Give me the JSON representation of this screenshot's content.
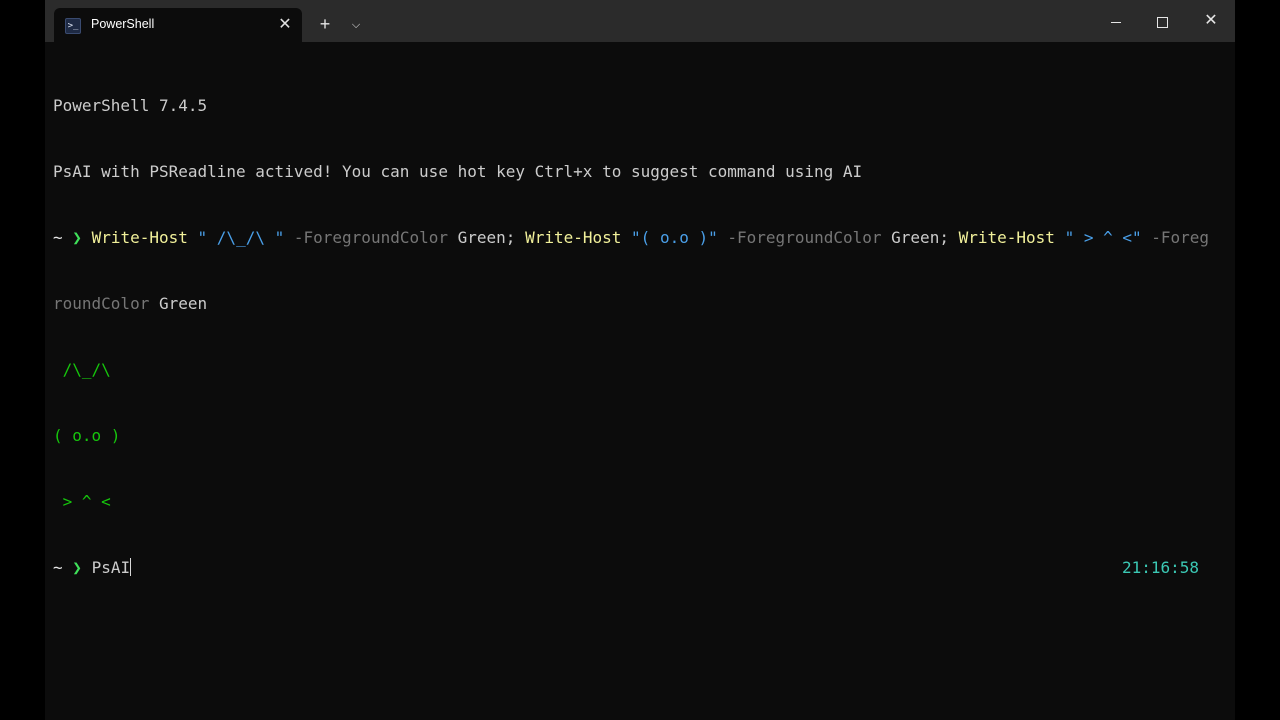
{
  "tab": {
    "icon": "powershell-icon",
    "title": "PowerShell",
    "close": "✕"
  },
  "titlebar": {
    "new_tab": "+",
    "dropdown": "⌵",
    "close": "✕"
  },
  "terminal": {
    "banner_version": "PowerShell 7.4.5",
    "banner_message": "PsAI with PSReadline actived! You can use hot key Ctrl+x to suggest command using AI",
    "prompt_tilde": "~",
    "prompt_chevron": "❯",
    "command1": {
      "c1": "Write-Host",
      "s1": "\" /\\_/\\ \"",
      "p1": "-ForegroundColor",
      "v1": "Green;",
      "c2": "Write-Host",
      "s2": "\"( o.o )\"",
      "p2": "-ForegroundColor",
      "v2": "Green;",
      "c3": "Write-Host",
      "s3": "\" > ^ <\"",
      "p3a": "-Foreg",
      "p3b": "roundColor",
      "v3": "Green"
    },
    "output": [
      " /\\_/\\",
      "( o.o )",
      " > ^ <"
    ],
    "current_input": "PsAI",
    "clock": "21:16:58"
  }
}
